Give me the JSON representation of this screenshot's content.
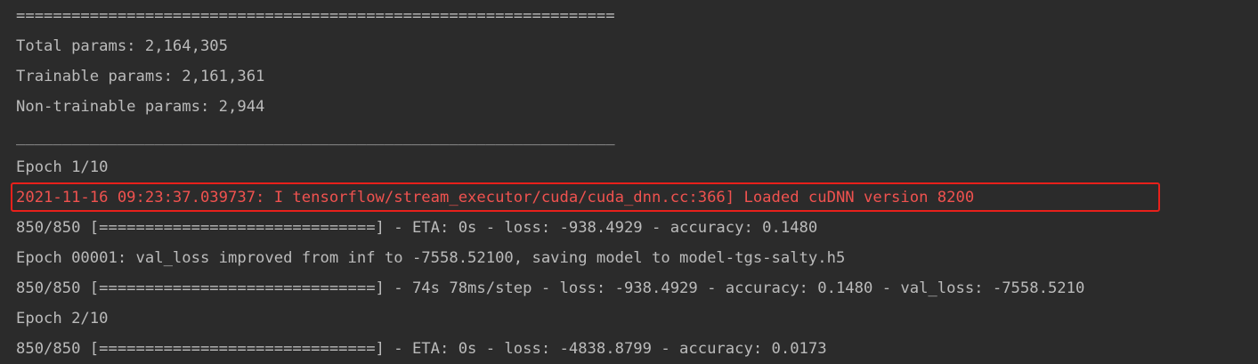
{
  "console": {
    "lines": [
      "=================================================================",
      "Total params: 2,164,305",
      "Trainable params: 2,161,361",
      "Non-trainable params: 2,944",
      "_________________________________________________________________",
      "Epoch 1/10",
      "2021-11-16 09:23:37.039737: I tensorflow/stream_executor/cuda/cuda_dnn.cc:366] Loaded cuDNN version 8200",
      "850/850 [==============================] - ETA: 0s - loss: -938.4929 - accuracy: 0.1480",
      "Epoch 00001: val_loss improved from inf to -7558.52100, saving model to model-tgs-salty.h5",
      "850/850 [==============================] - 74s 78ms/step - loss: -938.4929 - accuracy: 0.1480 - val_loss: -7558.5210",
      "Epoch 2/10",
      "850/850 [==============================] - ETA: 0s - loss: -4838.8799 - accuracy: 0.0173"
    ]
  },
  "colors": {
    "background": "#2b2b2b",
    "text": "#bbbbbb",
    "error_text": "#f0524f",
    "highlight_border": "#e8201b"
  }
}
